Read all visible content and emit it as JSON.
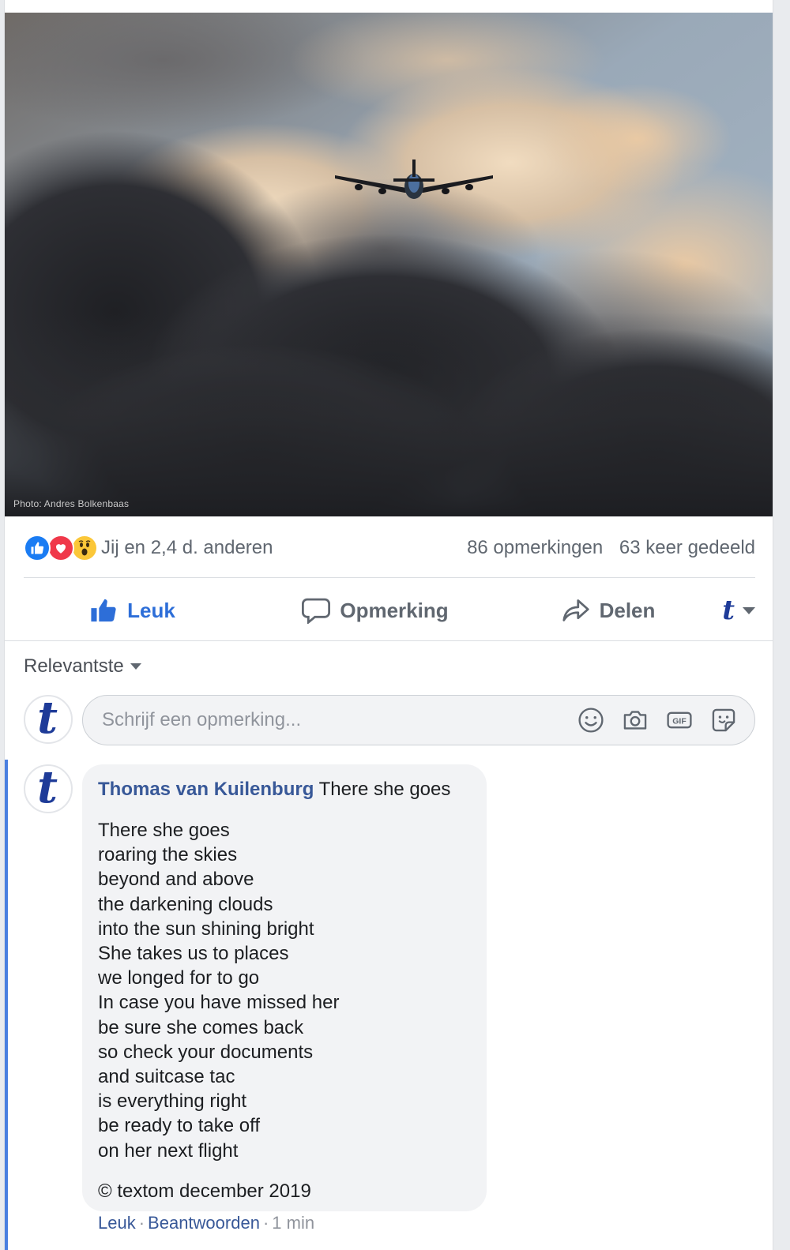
{
  "photo": {
    "credit": "Photo: Andres Bolkenbaas",
    "description_icon": "airplane-in-clouds-photo"
  },
  "reactions": {
    "summary": "Jij en 2,4 d. anderen",
    "comments_count": "86 opmerkingen",
    "shares_count": "63 keer gedeeld",
    "icons": [
      "like-icon",
      "love-icon",
      "wow-icon"
    ]
  },
  "actions": {
    "like": "Leuk",
    "comment": "Opmerking",
    "share": "Delen",
    "page_letter": "t"
  },
  "comments": {
    "sort_label": "Relevantste",
    "composer_placeholder": "Schrijf een opmerking...",
    "avatar_letter": "t",
    "items": [
      {
        "author": "Thomas van Kuilenburg",
        "title": "There she goes",
        "avatar_letter": "t",
        "poem": [
          "There she goes",
          "roaring the skies",
          "beyond and above",
          "the darkening clouds",
          "into the sun shining bright",
          "She takes us to places",
          "we longed for to go",
          "In case you have missed her",
          "be sure she comes back",
          "so check your documents",
          "and suitcase tac",
          "is everything right",
          "be ready to take off",
          "on her next flight"
        ],
        "copyright": "© textom december 2019",
        "meta": {
          "like": "Leuk",
          "reply": "Beantwoorden",
          "time": "1 min",
          "dot": "·"
        }
      }
    ]
  },
  "colors": {
    "facebook_blue": "#385898",
    "like_blue": "#1a7cf3",
    "love_red": "#f0384a",
    "wow_yellow": "#fbc739"
  }
}
